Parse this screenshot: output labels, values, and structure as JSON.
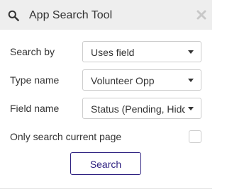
{
  "header": {
    "title": "App Search Tool",
    "icon": "search-icon",
    "close_icon": "close-icon"
  },
  "form": {
    "search_by": {
      "label": "Search by",
      "value": "Uses field"
    },
    "type_name": {
      "label": "Type name",
      "value": "Volunteer Opp"
    },
    "field_name": {
      "label": "Field name",
      "value": "Status (Pending, Hidden, Active)"
    },
    "only_current_page": {
      "label": "Only search current page",
      "checked": false
    }
  },
  "actions": {
    "search_label": "Search"
  },
  "colors": {
    "header_bg": "#eeeeee",
    "accent": "#2d2080",
    "border": "#cccccc",
    "text": "#333333"
  }
}
